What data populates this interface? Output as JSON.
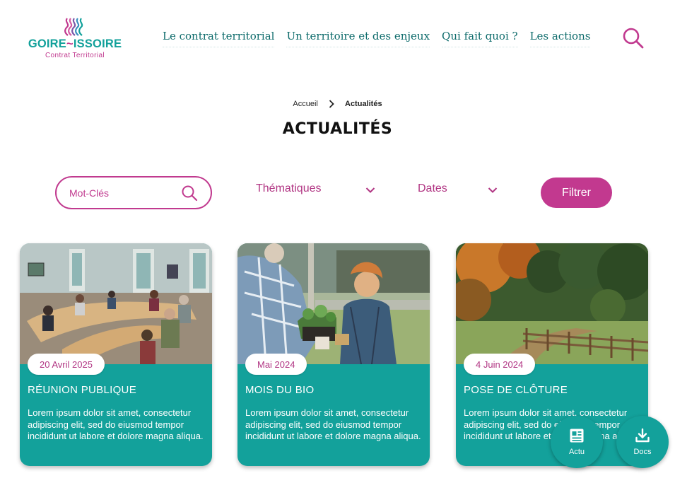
{
  "header": {
    "logo": {
      "name_left": "GOIRE",
      "name_right": "ISSOIRE",
      "subtitle": "Contrat Territorial"
    },
    "nav": [
      {
        "label": "Le contrat territorial"
      },
      {
        "label": "Un territoire et des enjeux"
      },
      {
        "label": "Qui fait quoi ?"
      },
      {
        "label": "Les actions"
      }
    ],
    "search_icon": "search-icon"
  },
  "breadcrumb": {
    "home": "Accueil",
    "current": "Actualités"
  },
  "page_title": "ACTUALITÉS",
  "filters": {
    "keyword_placeholder": "Mot-Clés",
    "thematiques": "Thématiques",
    "dates": "Dates",
    "submit": "Filtrer"
  },
  "cards": [
    {
      "date": "20 Avril 2025",
      "title": "RÉUNION PUBLIQUE",
      "body": "Lorem ipsum dolor sit amet, consectetur adipiscing elit, sed do eiusmod tempor incididunt ut labore et dolore magna aliqua.",
      "image": "meeting-room-photo"
    },
    {
      "date": "Mai 2024",
      "title": "MOIS DU BIO",
      "body": "Lorem ipsum dolor sit amet, consectetur adipiscing elit, sed do eiusmod tempor incididunt ut labore et dolore magna aliqua.",
      "image": "plants-exchange-photo"
    },
    {
      "date": "4 Juin 2024",
      "title": "POSE DE CLÔTURE",
      "body": "Lorem ipsum dolor sit amet, consectetur adipiscing elit, sed do eiusmod tempor incididunt ut labore et dolore magna aliqua.",
      "image": "wooden-fence-photo"
    }
  ],
  "fabs": {
    "news_label": "Actu",
    "docs_label": "Docs"
  },
  "colors": {
    "teal": "#13a19b",
    "magenta": "#c2398f",
    "nav_text": "#0d6b6b"
  }
}
